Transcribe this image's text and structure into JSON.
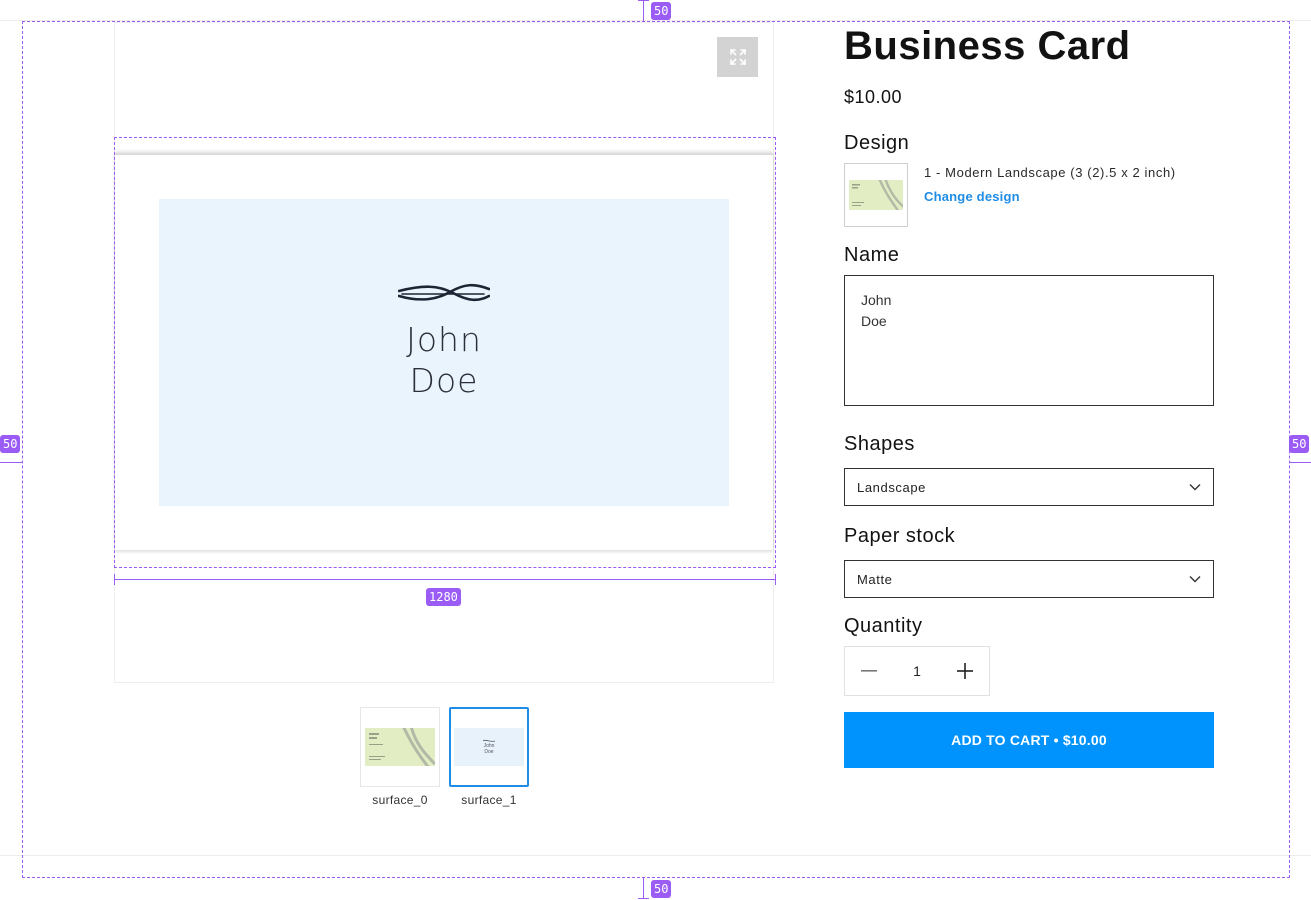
{
  "product": {
    "title": "Business Card",
    "price": "$10.00"
  },
  "design": {
    "label": "Design",
    "description": "1 - Modern Landscape (3 (2).5 x 2 inch)",
    "change_link": "Change design"
  },
  "name_field": {
    "label": "Name",
    "value": "John\nDoe"
  },
  "shapes": {
    "label": "Shapes",
    "selected": "Landscape"
  },
  "paper_stock": {
    "label": "Paper stock",
    "selected": "Matte"
  },
  "quantity": {
    "label": "Quantity",
    "value": "1"
  },
  "add_to_cart": {
    "label": "ADD TO CART • $10.00"
  },
  "preview": {
    "card_name": "John\nDoe",
    "card_background": "#eaf4fd"
  },
  "thumbnails": [
    {
      "label": "surface_0",
      "active": false
    },
    {
      "label": "surface_1",
      "active": true
    }
  ],
  "overlay": {
    "top_spacing": "50",
    "bottom_spacing": "50",
    "left_spacing": "50",
    "right_spacing": "50",
    "canvas_width": "1280"
  },
  "colors": {
    "accent": "#0093fd",
    "link": "#1f8de6",
    "guide": "#9b5cf5"
  }
}
